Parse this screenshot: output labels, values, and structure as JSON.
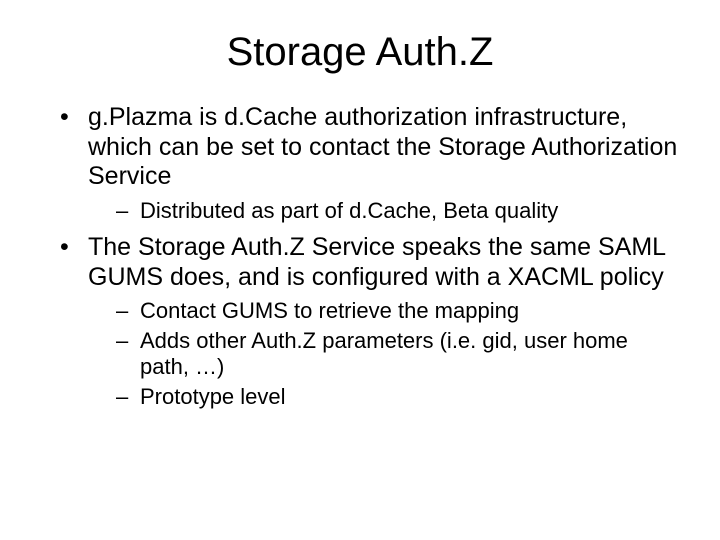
{
  "title": "Storage Auth.Z",
  "bullets": [
    {
      "text": "g.Plazma is d.Cache authorization infrastructure, which can be set to contact the Storage Authorization Service",
      "sub": [
        {
          "text": "Distributed as part of d.Cache, Beta quality"
        }
      ]
    },
    {
      "text": "The Storage Auth.Z Service speaks the same SAML GUMS does, and is configured with a XACML policy",
      "sub": [
        {
          "text": "Contact GUMS to retrieve the mapping"
        },
        {
          "text": "Adds other Auth.Z parameters (i.e. gid, user home path, …)"
        },
        {
          "text": "Prototype level"
        }
      ]
    }
  ]
}
